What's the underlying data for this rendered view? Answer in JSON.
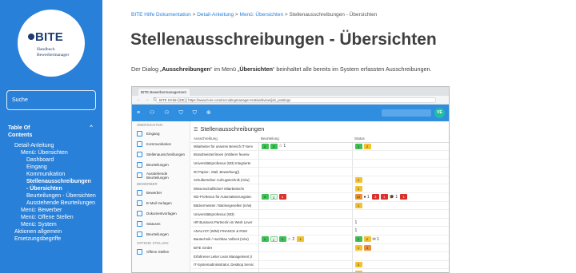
{
  "sidebar": {
    "logo": {
      "brand": "BITE",
      "line1": "Handbuch",
      "line2": "Bewerbermanager"
    },
    "search_placeholder": "Suche",
    "toc_caption": "Table Of Contents",
    "chevron_up": "⌃",
    "items": [
      {
        "label": "Detail-Anleitung",
        "level": 0
      },
      {
        "label": "Menü: Übersichten",
        "level": 1
      },
      {
        "label": "Dashboard",
        "level": 2
      },
      {
        "label": "Eingang",
        "level": 2
      },
      {
        "label": "Kommunikation",
        "level": 2
      },
      {
        "label": "Stellenausschreibungen - Übersichten",
        "level": 2
      },
      {
        "label": "Beurteilungen - Übersichten",
        "level": 2
      },
      {
        "label": "Ausstehende Beurteilungen",
        "level": 2
      },
      {
        "label": "Menü: Bewerber",
        "level": 1
      },
      {
        "label": "Menü: Offene Stellen",
        "level": 1
      },
      {
        "label": "Menü: System",
        "level": 1
      },
      {
        "label": "Aktionen allgemein",
        "level": 0
      },
      {
        "label": "Ersetzungsbegriffe",
        "level": 0
      }
    ]
  },
  "breadcrumb": {
    "home": "BITE Hilfe Dokumentation",
    "sep": ">",
    "level1": "Detail-Anleitung",
    "level2": "Menü: Übersichten",
    "current": "Stellenausschreibungen - Übersichten"
  },
  "page": {
    "title": "Stellenausschreibungen - Übersichten",
    "para_start": "Der Dialog „",
    "para_b1": "Ausschreibungen",
    "para_mid": "“ im Menü „",
    "para_b2": "Übersichten",
    "para_end": "“ beinhaltet alle bereits im System erfassten Ausschreibungen."
  },
  "screenshot": {
    "tab": "BITE Bewerbermanagement",
    "nav_icons": "← → C",
    "url": "BITE GmbH [DE] | https://www.b-ite.com/recruitingmanager-test/webview/job_postings",
    "header_icons": "≡ ⚇ ⚇ ⛉ ⛉ ⊕",
    "avatar": "VE",
    "page_title": "Stellenausschreibungen",
    "menu_icon": "☰",
    "sections": [
      {
        "label": "ÜBERSICHTEN",
        "items": [
          "Eingang",
          "Kommunikation",
          "Stellenausschreibungen",
          "Beurteilungen",
          "Ausstehende Beurteilungen"
        ]
      },
      {
        "label": "BEWERBER",
        "items": [
          "Bewerber",
          "E-Mail Vorlagen",
          "Dokumentvorlagen",
          "Statuses",
          "Beurteilungen"
        ]
      },
      {
        "label": "OFFENE STELLEN",
        "items": [
          "Offene Stellen"
        ]
      }
    ],
    "columns": [
      "Ausschreibung",
      "Beurteilung",
      "Status"
    ],
    "rows": [
      {
        "name": "Mitarbeiter für unseren Bereich IT-Serv",
        "rating": [
          [
            "g",
            "2"
          ],
          [
            "g",
            "3"
          ],
          [
            "plain",
            "☆ 1"
          ]
        ],
        "status": [
          [
            "g",
            "1"
          ],
          [
            "y",
            "2"
          ]
        ]
      },
      {
        "name": "Brandmeister/innen (mittlerer feuerw",
        "rating": [],
        "status": []
      },
      {
        "name": "Universitätsprofessur (W3) Integrierte",
        "rating": [],
        "status": []
      },
      {
        "name": "00 Papier-, Mail, Bewerbung))",
        "rating": [],
        "status": []
      },
      {
        "name": "Schulbetreiber Aufzugstechnik (m/w)",
        "rating": [],
        "status": [
          [
            "y",
            "1"
          ]
        ]
      },
      {
        "name": "Wissenschaftliche/r Mitarbeiter/in",
        "rating": [],
        "status": [
          [
            "y",
            "1"
          ]
        ]
      },
      {
        "name": "W2-Professur für Automatisierungstec",
        "rating": [
          [
            "g",
            "4"
          ],
          [
            "lg",
            "3"
          ],
          [
            "r",
            "4"
          ]
        ],
        "status": [
          [
            "o",
            "12"
          ],
          [
            "plain",
            "● 1"
          ],
          [
            "r",
            "3"
          ],
          [
            "r",
            "1"
          ],
          [
            "plain",
            "🎓 1"
          ],
          [
            "r",
            "1"
          ]
        ]
      },
      {
        "name": "Bäckermeister / Bäckergesellen (m/w)",
        "rating": [],
        "status": [
          [
            "y",
            "1"
          ]
        ]
      },
      {
        "name": "Universitätsprofessur (W3)",
        "rating": [],
        "status": []
      },
      {
        "name": "HR Business Partner/in im Werk Lever",
        "rating": [],
        "status": [
          [
            "plain",
            "1"
          ]
        ]
      },
      {
        "name": "ANALYST (W/M) FINANCE & RISK",
        "rating": [],
        "status": [
          [
            "plain",
            "1"
          ]
        ]
      },
      {
        "name": "Bautechnik / Hochbau Vollzeit (m/w)",
        "rating": [
          [
            "g",
            "1"
          ],
          [
            "lg",
            "2"
          ],
          [
            "g",
            "2"
          ],
          [
            "plain",
            "☆ 2"
          ],
          [
            "y",
            "1"
          ]
        ],
        "status": [
          [
            "g",
            "2"
          ],
          [
            "y",
            "2"
          ],
          [
            "plain",
            "✉ 1"
          ]
        ]
      },
      {
        "name": "BITE GmbH",
        "rating": [],
        "status": [
          [
            "y",
            "1"
          ],
          [
            "o",
            "3"
          ]
        ]
      },
      {
        "name": "Erfahrener Leiter Lean Management (r",
        "rating": [],
        "status": []
      },
      {
        "name": "IT-Systemadministrator, Desktop Servic",
        "rating": [],
        "status": [
          [
            "y",
            "2"
          ]
        ]
      },
      {
        "name": "",
        "rating": [],
        "status": [
          [
            "y",
            "1"
          ]
        ]
      }
    ]
  }
}
